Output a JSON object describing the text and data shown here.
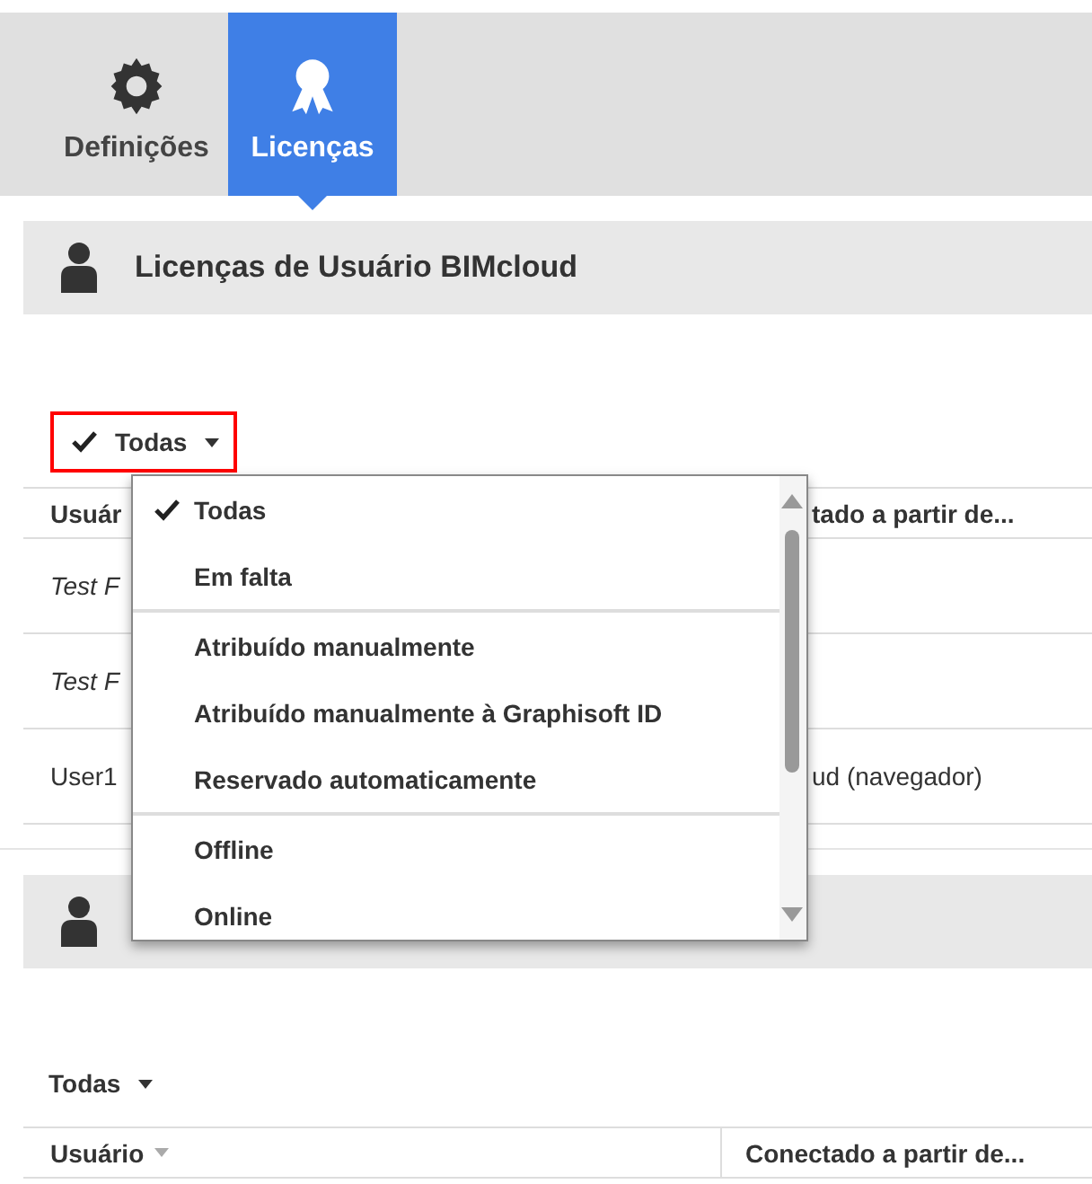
{
  "tabs": [
    {
      "label": "Definições",
      "selected": false
    },
    {
      "label": "Licenças",
      "selected": true
    }
  ],
  "sections": [
    {
      "title": "Licenças de Usuário BIMcloud",
      "filter": {
        "label": "Todas",
        "checked": true,
        "highlighted": true
      },
      "table": {
        "columns": [
          {
            "label": "Usuár"
          },
          {
            "label": "tado a partir de..."
          }
        ],
        "rows": [
          {
            "kind": "pending",
            "cells": [
              "Test F",
              ""
            ]
          },
          {
            "kind": "pending",
            "cells": [
              "Test F",
              ""
            ]
          },
          {
            "kind": "user",
            "cells": [
              "User1",
              "ud (navegador)"
            ]
          }
        ]
      }
    },
    {
      "filter": {
        "label": "Todas",
        "checked": false,
        "highlighted": false
      },
      "table": {
        "columns": [
          {
            "label": "Usuário",
            "sortable": true
          },
          {
            "label": "Conectado a partir de...",
            "sortable": false
          }
        ]
      }
    }
  ],
  "dropdown": {
    "groups": [
      [
        {
          "label": "Todas",
          "selected": true
        },
        {
          "label": "Em falta",
          "selected": false
        }
      ],
      [
        {
          "label": "Atribuído manualmente",
          "selected": false
        },
        {
          "label": "Atribuído manualmente à Graphisoft ID",
          "selected": false
        },
        {
          "label": "Reservado automaticamente",
          "selected": false
        }
      ],
      [
        {
          "label": "Offline",
          "selected": false
        },
        {
          "label": "Online",
          "selected": false
        }
      ]
    ]
  }
}
